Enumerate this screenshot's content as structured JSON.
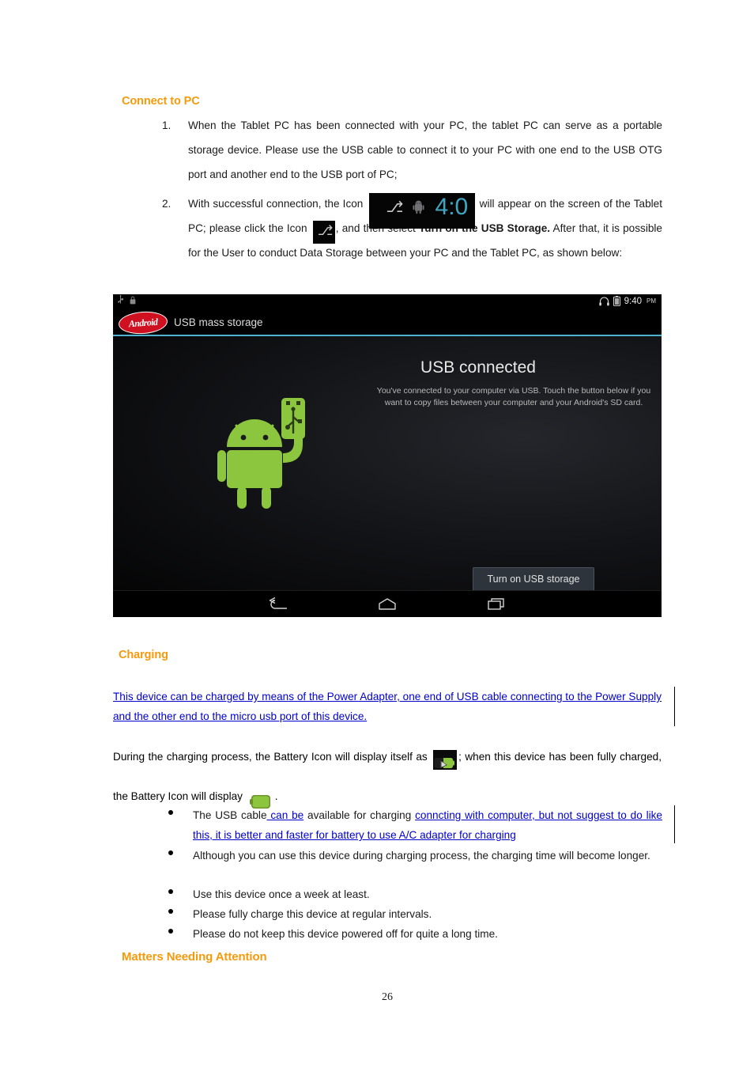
{
  "document": {
    "page_number": "26"
  },
  "sections": {
    "connect_to_pc": {
      "heading": "Connect to PC",
      "items": [
        {
          "marker": "1.",
          "text": "When the Tablet PC has been connected with your PC, the tablet PC can serve as a portable storage device. Please use the USB cable to connect it to your PC with one end to the USB OTG port and another end to the USB port of PC;"
        },
        {
          "marker": "2.",
          "part1": "With successful connection, the Icon",
          "part2": "will appear on the screen of the Tablet PC; please click the Icon",
          "part3": ", and then select",
          "bold": "Turn on the USB Storage.",
          "part4": "After that, it is possible for the User to conduct Data Storage between your PC and the Tablet PC, as shown below:"
        }
      ]
    },
    "charging": {
      "heading": "Charging",
      "inserted_paragraph": "This device can be charged by means of the Power Adapter, one end of USB cable connecting to the Power Supply and the other end to the micro usb port of this device.",
      "battery_paragraph": {
        "part1": "During the charging process, the Battery Icon will display itself as",
        "part2": "; when this device has been fully charged, the Battery Icon will display",
        "part3": "."
      },
      "bullets": [
        {
          "plain1": "The USB cable",
          "ins1": " can be",
          "plain2": " available for charging ",
          "ins2": "conncting with computer, but not suggest to do like this, it is better and faster for battery to use A/C adapter for charging"
        },
        {
          "plain1": "Although you can use this device during charging process, the charging time will become longer."
        },
        {
          "plain1": "Use this device once a week at least."
        },
        {
          "plain1": "Please fully charge this device at regular intervals."
        },
        {
          "plain1": "Please do not keep this device powered off for quite a long time."
        }
      ]
    },
    "matters": {
      "heading": "Matters Needing Attention"
    }
  },
  "android_screenshot": {
    "status_bar": {
      "usb_icon": "usb-icon",
      "lock_icon": "lock-icon",
      "headphone_icon": "headphone-icon",
      "battery_icon": "battery-icon",
      "clock": "9:40",
      "ampm": "PM"
    },
    "notification": {
      "logo_text": "Android",
      "label": "USB mass storage"
    },
    "title": "USB connected",
    "description": "You've connected to your computer via USB. Touch the button below if you want to copy files between your computer and your Android's SD card.",
    "button_label": "Turn on USB storage",
    "nav": {
      "back": "back-icon",
      "home": "home-icon",
      "recents": "recent-apps-icon"
    },
    "colors": {
      "android_green": "#8CC63E",
      "divider_blue": "#4FB3D0",
      "clock_cyan": "#3EA8C4"
    }
  },
  "inline_icons": {
    "statusbar_chip_clock": "4:0",
    "usb_glyph": "⚇",
    "battery_charging": "battery-charging-icon",
    "battery_full": "battery-full-icon"
  },
  "theme": {
    "heading_orange": "#F59A0B",
    "inserted_blue": "#0000CC"
  }
}
